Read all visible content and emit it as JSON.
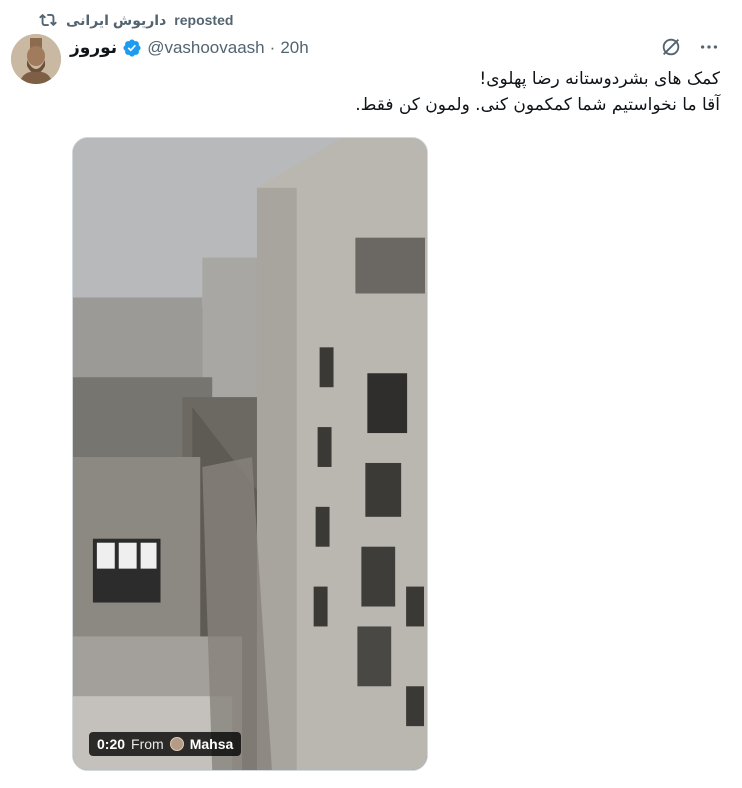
{
  "repost": {
    "icon": "repost-icon",
    "reposter_name": "داریوش ایرانی",
    "label": "reposted"
  },
  "author": {
    "display_name": "نوروز",
    "verified": true,
    "handle": "@vashoovaash",
    "separator": "·",
    "time": "20h",
    "avatar": "avatar"
  },
  "actions": {
    "grok_icon": "grok-icon",
    "more_icon": "more-icon"
  },
  "tweet": {
    "line1": "کمک های بشردوستانه رضا پهلوی!",
    "line2": "آقا ما نخواستیم شما کمکمون کنی. ولمون کن فقط."
  },
  "media": {
    "type": "video",
    "duration": "0:20",
    "from_label": "From",
    "source_name": "Mahsa"
  },
  "colors": {
    "text": "#0f1419",
    "secondary": "#536471",
    "verified": "#1d9bf0"
  }
}
